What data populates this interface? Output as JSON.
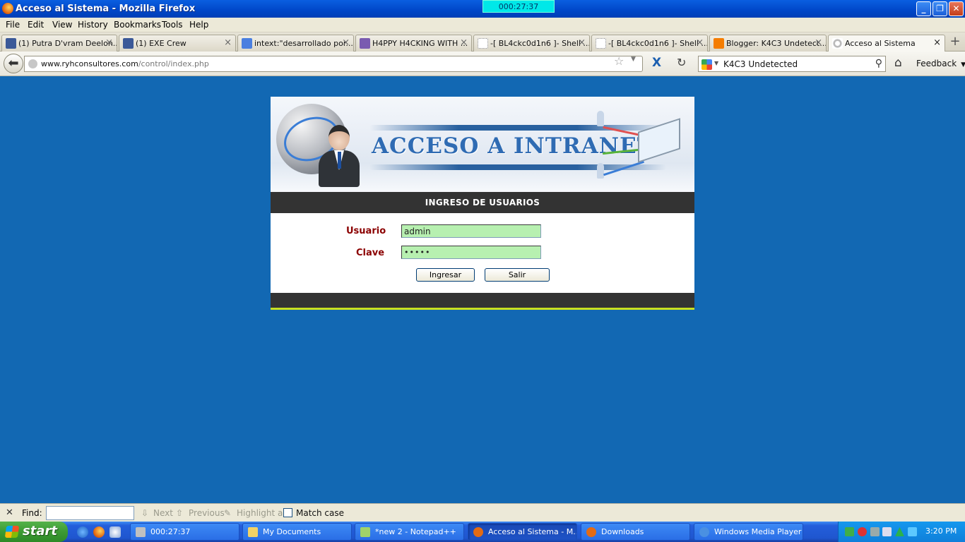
{
  "window": {
    "title": "Acceso al Sistema - Mozilla Firefox",
    "timer": "000:27:37"
  },
  "menu": [
    "File",
    "Edit",
    "View",
    "History",
    "Bookmarks",
    "Tools",
    "Help"
  ],
  "tabs": [
    {
      "label": "(1) Putra D'vram Deelon...",
      "icon_color": "#3b5998"
    },
    {
      "label": "(1) EXE Crew",
      "icon_color": "#3b5998"
    },
    {
      "label": "intext:\"desarrollado por...",
      "icon_color": "#4a7fe0"
    },
    {
      "label": "H4PPY H4CKING WITH ...",
      "icon_color": "#7a5bb0"
    },
    {
      "label": "-[ BL4ckc0d1n6 ]- Shell ...",
      "icon_color": "#ffffff"
    },
    {
      "label": "-[ BL4ckc0d1n6 ]- Shell ...",
      "icon_color": "#ffffff"
    },
    {
      "label": "Blogger: K4C3 Undetect...",
      "icon_color": "#f57d00"
    },
    {
      "label": "Acceso al Sistema",
      "icon_color": "#cccccc",
      "active": true
    }
  ],
  "nav": {
    "url_host": "www.ryhconsultores.com",
    "url_path": "/control/index.php",
    "search_text": "K4C3 Undetected",
    "feedback_label": "Feedback"
  },
  "login": {
    "banner_title": "ACCESO A INTRANET",
    "section_title": "INGRESO DE USUARIOS",
    "user_label": "Usuario",
    "user_value": "admin",
    "pass_label": "Clave",
    "pass_value": "•••••",
    "submit_label": "Ingresar",
    "exit_label": "Salir"
  },
  "findbar": {
    "find_label": "Find:",
    "next_label": "Next",
    "previous_label": "Previous",
    "highlight_label": "Highlight all",
    "match_case_label": "Match case"
  },
  "taskbar": {
    "start_label": "start",
    "tasks": [
      {
        "label": "000:27:37",
        "icon_color": "#c0c0c0"
      },
      {
        "label": "My Documents",
        "icon_color": "#f2d266"
      },
      {
        "label": "*new  2 - Notepad++",
        "icon_color": "#9fd36a"
      },
      {
        "label": "Acceso al Sistema - M...",
        "icon_color": "#e46b14",
        "active": true
      },
      {
        "label": "Downloads",
        "icon_color": "#e46b14"
      },
      {
        "label": "Windows Media Player",
        "icon_color": "#4a90e2"
      }
    ],
    "clock": "3:20 PM"
  }
}
